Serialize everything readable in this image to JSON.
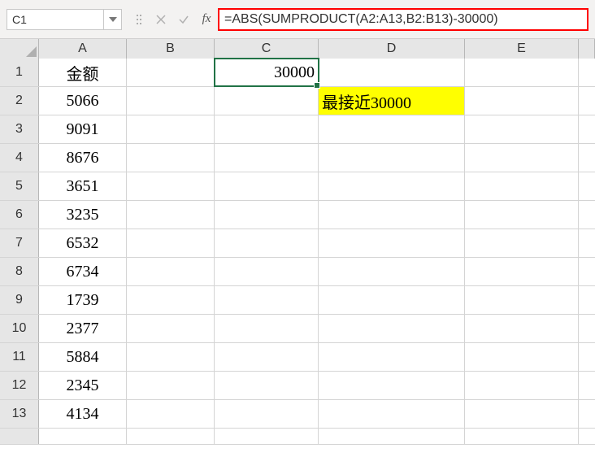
{
  "name_box": "C1",
  "formula": "=ABS(SUMPRODUCT(A2:A13,B2:B13)-30000)",
  "columns": [
    "A",
    "B",
    "C",
    "D",
    "E"
  ],
  "row_numbers": [
    "1",
    "2",
    "3",
    "4",
    "5",
    "6",
    "7",
    "8",
    "9",
    "10",
    "11",
    "12",
    "13"
  ],
  "cells": {
    "A1": "金额",
    "A2": "5066",
    "A3": "9091",
    "A4": "8676",
    "A5": "3651",
    "A6": "3235",
    "A7": "6532",
    "A8": "6734",
    "A9": "1739",
    "A10": "2377",
    "A11": "5884",
    "A12": "2345",
    "A13": "4134",
    "C1": "30000",
    "D2": "最接近30000"
  },
  "selected_cell": "C1",
  "highlight_cell": "D2"
}
